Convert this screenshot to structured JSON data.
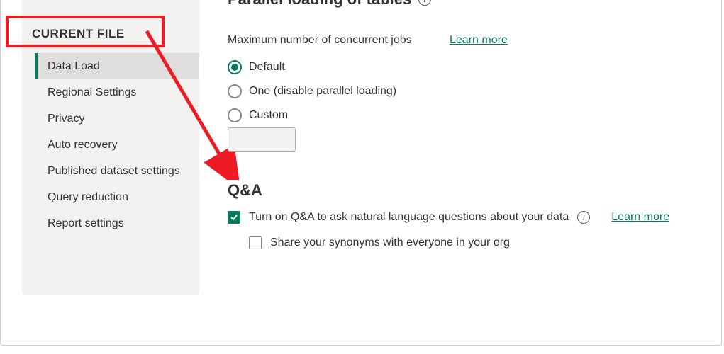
{
  "sidebar": {
    "header": "CURRENT FILE",
    "items": [
      {
        "label": "Data Load",
        "selected": true
      },
      {
        "label": "Regional Settings",
        "selected": false
      },
      {
        "label": "Privacy",
        "selected": false
      },
      {
        "label": "Auto recovery",
        "selected": false
      },
      {
        "label": "Published dataset settings",
        "selected": false
      },
      {
        "label": "Query reduction",
        "selected": false
      },
      {
        "label": "Report settings",
        "selected": false
      }
    ]
  },
  "main": {
    "parallel": {
      "heading": "Parallel loading of tables",
      "row_label": "Maximum number of concurrent jobs",
      "learn_more": "Learn more",
      "options": [
        {
          "label": "Default",
          "checked": true
        },
        {
          "label": "One (disable parallel loading)",
          "checked": false
        },
        {
          "label": "Custom",
          "checked": false
        }
      ],
      "custom_value": ""
    },
    "qa": {
      "heading": "Q&A",
      "turn_on_label": "Turn on Q&A to ask natural language questions about your data",
      "turn_on_checked": true,
      "learn_more": "Learn more",
      "share_label": "Share your synonyms with everyone in your org",
      "share_checked": false
    }
  }
}
